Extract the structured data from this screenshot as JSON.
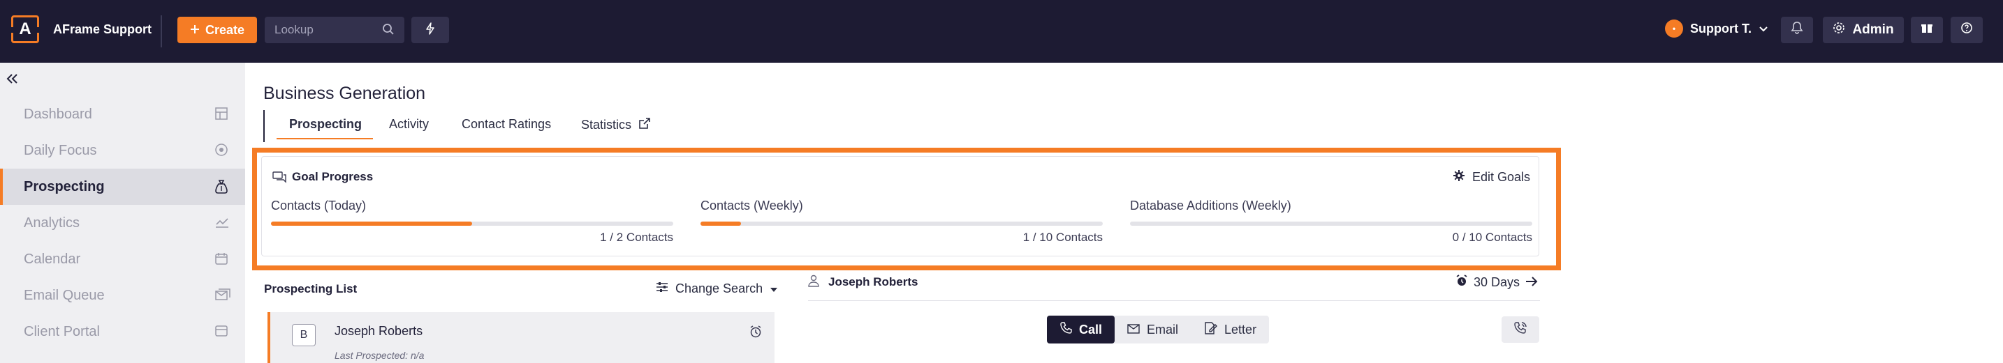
{
  "topbar": {
    "brand": "AFrame Support",
    "logo_letter": "A",
    "create_label": "Create",
    "lookup_placeholder": "Lookup",
    "user_initial": "•",
    "user_name": "Support T.",
    "admin_label": "Admin"
  },
  "sidebar": {
    "items": [
      {
        "label": "Dashboard",
        "icon": "grid-icon"
      },
      {
        "label": "Daily Focus",
        "icon": "target-icon"
      },
      {
        "label": "Prospecting",
        "icon": "money-bag-icon",
        "active": true
      },
      {
        "label": "Analytics",
        "icon": "chart-icon"
      },
      {
        "label": "Calendar",
        "icon": "calendar-icon"
      },
      {
        "label": "Email Queue",
        "icon": "mail-queue-icon"
      },
      {
        "label": "Client Portal",
        "icon": "portal-icon"
      }
    ]
  },
  "page": {
    "title": "Business Generation",
    "tabs": [
      "Prospecting",
      "Activity",
      "Contact Ratings",
      "Statistics"
    ]
  },
  "goals": {
    "title": "Goal Progress",
    "edit_label": "Edit Goals",
    "items": [
      {
        "label": "Contacts (Today)",
        "value": "1 / 2 Contacts",
        "progress": 0.5
      },
      {
        "label": "Contacts (Weekly)",
        "value": "1 / 10 Contacts",
        "progress": 0.1
      },
      {
        "label": "Database Additions (Weekly)",
        "value": "0 / 10 Contacts",
        "progress": 0
      }
    ]
  },
  "prospect_list": {
    "title": "Prospecting List",
    "change_search": "Change Search",
    "row": {
      "badge": "B",
      "name": "Joseph Roberts",
      "last": "Last Prospected: n/a"
    }
  },
  "contact": {
    "name": "Joseph Roberts",
    "days": "30 Days",
    "actions": [
      "Call",
      "Email",
      "Letter"
    ]
  },
  "colors": {
    "accent": "#f57c25",
    "nav_bg": "#1d1b33"
  }
}
